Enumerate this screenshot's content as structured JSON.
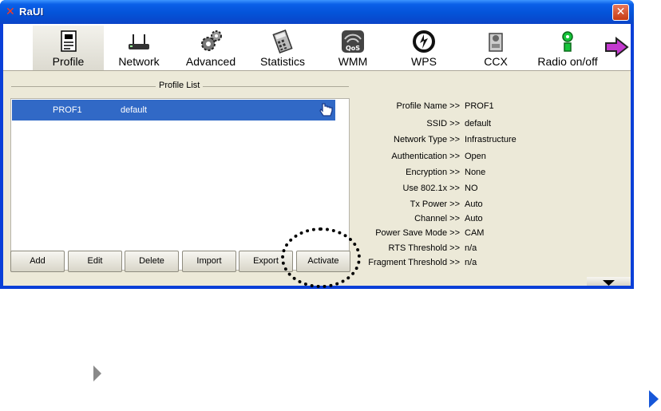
{
  "window": {
    "title": "RaUI",
    "close_icon": "close-icon",
    "app_icon": "ralink-logo-icon"
  },
  "toolbar": {
    "items": [
      {
        "label": "Profile",
        "icon": "profile-icon",
        "active": true
      },
      {
        "label": "Network",
        "icon": "network-router-icon"
      },
      {
        "label": "Advanced",
        "icon": "gears-icon"
      },
      {
        "label": "Statistics",
        "icon": "calculator-icon"
      },
      {
        "label": "WMM",
        "icon": "qos-icon"
      },
      {
        "label": "WPS",
        "icon": "wps-icon"
      },
      {
        "label": "CCX",
        "icon": "ccx-icon"
      },
      {
        "label": "Radio on/off",
        "icon": "radio-antenna-icon"
      }
    ],
    "next_icon": "next-arrow-icon"
  },
  "profile_list": {
    "title": "Profile List",
    "rows": [
      {
        "profile": "PROF1",
        "ssid": "default",
        "status_icon": "pointing-hand-icon"
      }
    ]
  },
  "buttons": [
    "Add",
    "Edit",
    "Delete",
    "Import",
    "Export",
    "Activate"
  ],
  "details": [
    {
      "key": "Profile Name >>",
      "value": "PROF1"
    },
    {
      "key": "SSID >>",
      "value": "default"
    },
    {
      "key": "Network Type >>",
      "value": "Infrastructure"
    },
    {
      "key": "Authentication >>",
      "value": "Open"
    },
    {
      "key": "Encryption >>",
      "value": "None"
    },
    {
      "key": "Use 802.1x >>",
      "value": "NO"
    },
    {
      "key": "Tx Power >>",
      "value": "Auto"
    },
    {
      "key": "Channel >>",
      "value": "Auto"
    },
    {
      "key": "Power Save Mode >>",
      "value": "CAM"
    },
    {
      "key": "RTS Threshold >>",
      "value": "n/a"
    },
    {
      "key": "Fragment Threshold >>",
      "value": "n/a"
    }
  ],
  "colors": {
    "selection": "#3169c6",
    "titlebar": "#0453d8",
    "client_bg": "#ece9d8"
  }
}
